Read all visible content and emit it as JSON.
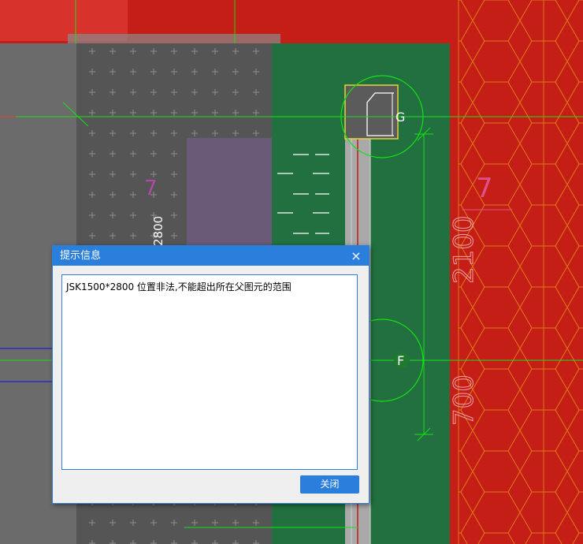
{
  "drawing": {
    "axis_labels": [
      "G",
      "F"
    ],
    "dimensions": [
      "2100",
      "700",
      "2800"
    ],
    "grid_numbers": [
      "7",
      "7"
    ],
    "colors": {
      "background_red": "#c41e17",
      "hatch_dark": "#555555",
      "panel_green": "#22703f",
      "column_grey": "#5b5b5b",
      "axis_line_green": "#16e016",
      "wall_purple": "#6a5a78"
    }
  },
  "dialog": {
    "title": "提示信息",
    "close_icon": "×",
    "message": "JSK1500*2800 位置非法,不能超出所在父图元的范围",
    "close_button": "关闭"
  }
}
